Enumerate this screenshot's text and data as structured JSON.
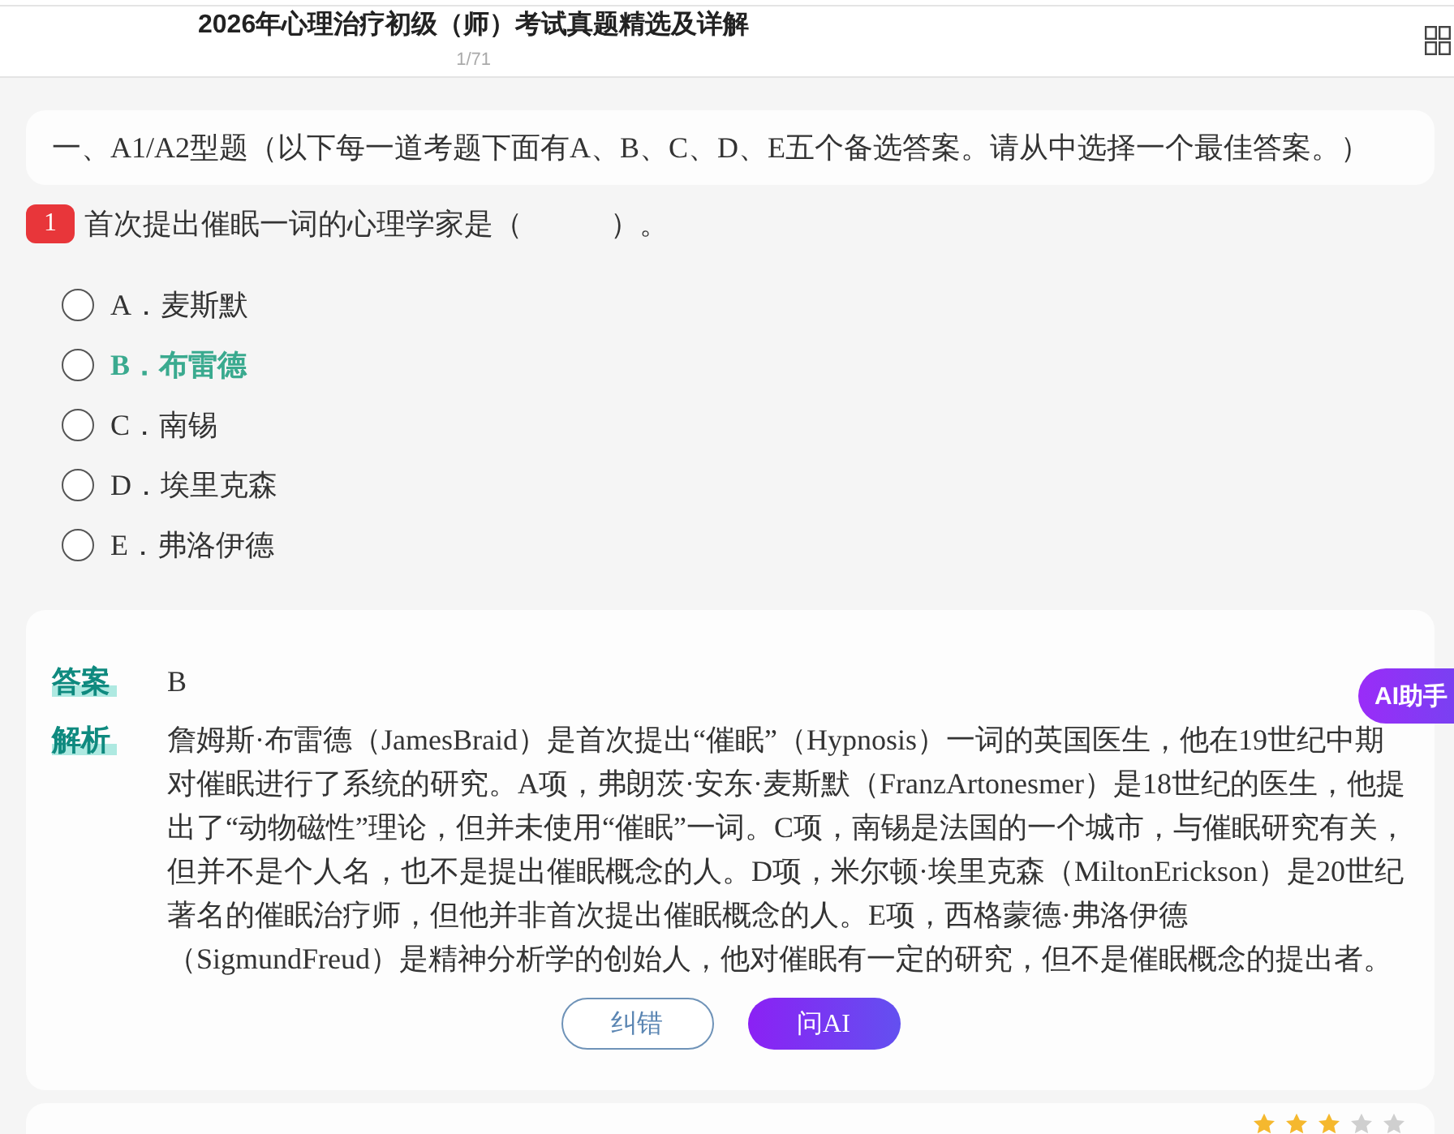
{
  "header": {
    "title": "2026年心理治疗初级（师）考试真题精选及详解",
    "counter": "1/71"
  },
  "section": {
    "heading": "一、A1/A2型题（以下每一道考题下面有A、B、C、D、E五个备选答案。请从中选择一个最佳答案。）"
  },
  "question": {
    "number": "1",
    "text": "首次提出催眠一词的心理学家是（　　　）。"
  },
  "options": [
    {
      "label": "A．麦斯默",
      "selected": false,
      "correct": false
    },
    {
      "label": "B．布雷德",
      "selected": false,
      "correct": true
    },
    {
      "label": "C．南锡",
      "selected": false,
      "correct": false
    },
    {
      "label": "D．埃里克森",
      "selected": false,
      "correct": false
    },
    {
      "label": "E．弗洛伊德",
      "selected": false,
      "correct": false
    }
  ],
  "answer": {
    "answer_label": "答案",
    "answer": "B",
    "analysis_label": "解析",
    "analysis": "詹姆斯·布雷德（JamesBraid）是首次提出“催眠”（Hypnosis）一词的英国医生，他在19世纪中期对催眠进行了系统的研究。A项，弗朗茨·安东·麦斯默（FranzArtonesmer）是18世纪的医生，他提出了“动物磁性”理论，但并未使用“催眠”一词。C项，南锡是法国的一个城市，与催眠研究有关，但并不是个人名，也不是提出催眠概念的人。D项，米尔顿·埃里克森（MiltonErickson）是20世纪著名的催眠治疗师，但他并非首次提出催眠概念的人。E项，西格蒙德·弗洛伊德（SigmundFreud）是精神分析学的创始人，他对催眠有一定的研究，但不是催眠概念的提出者。"
  },
  "buttons": [
    {
      "label": "纠错",
      "kind": "outline"
    },
    {
      "label": "问AI",
      "kind": "primary"
    }
  ],
  "ai_helper": {
    "label": "AI助手"
  },
  "next_card": {
    "stars": 3
  }
}
